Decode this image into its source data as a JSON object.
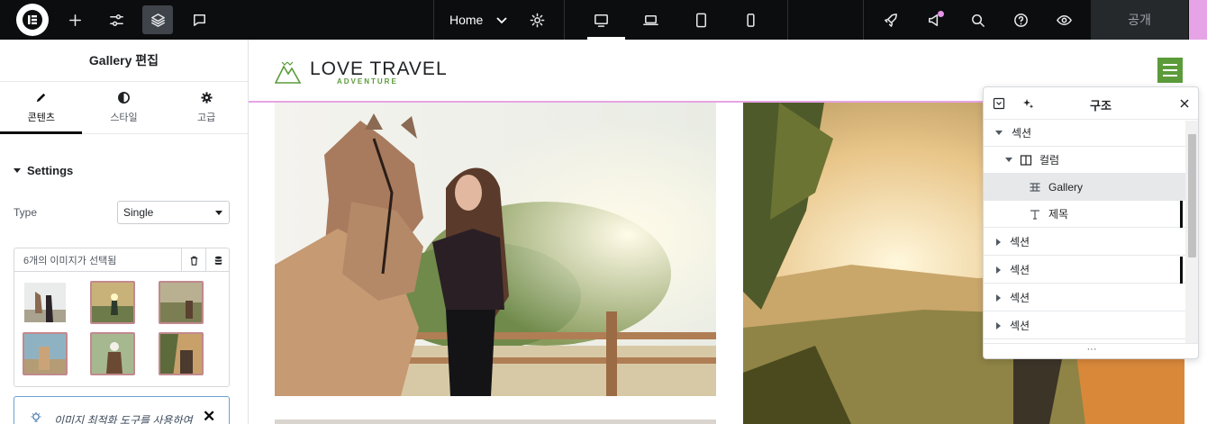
{
  "topbar": {
    "page_name": "Home",
    "publish_label": "공개"
  },
  "panel": {
    "title": "Gallery 편집",
    "tabs": [
      {
        "label": "콘텐츠",
        "icon": "pencil-icon"
      },
      {
        "label": "스타일",
        "icon": "half-circle-icon"
      },
      {
        "label": "고급",
        "icon": "gear-icon"
      }
    ],
    "section_title": "Settings",
    "type_label": "Type",
    "type_value": "Single",
    "gallery_selected": "6개의 이미지가 선택됨",
    "notice_text": "이미지 최적화 도구를 사용하여",
    "notice_close": "✕"
  },
  "site": {
    "logo_title": "LOVE TRAVEL",
    "logo_subtitle": "ADVENTURE"
  },
  "structure": {
    "title": "구조",
    "items": [
      {
        "label": "섹션",
        "icon": "caret-down-icon"
      },
      {
        "label": "컬럼",
        "icon": "column-icon"
      },
      {
        "label": "Gallery",
        "icon": "gallery-icon"
      },
      {
        "label": "제목",
        "icon": "heading-icon"
      },
      {
        "label": "섹션",
        "icon": "caret-right-icon"
      },
      {
        "label": "섹션",
        "icon": "caret-right-icon"
      },
      {
        "label": "섹션",
        "icon": "caret-right-icon"
      },
      {
        "label": "섹션",
        "icon": "caret-right-icon"
      }
    ],
    "footer": "···"
  },
  "colors": {
    "brand_green": "#5b9b3a",
    "editor_pink": "#e6a4e6",
    "topbar_bg": "#0c0d0e"
  }
}
